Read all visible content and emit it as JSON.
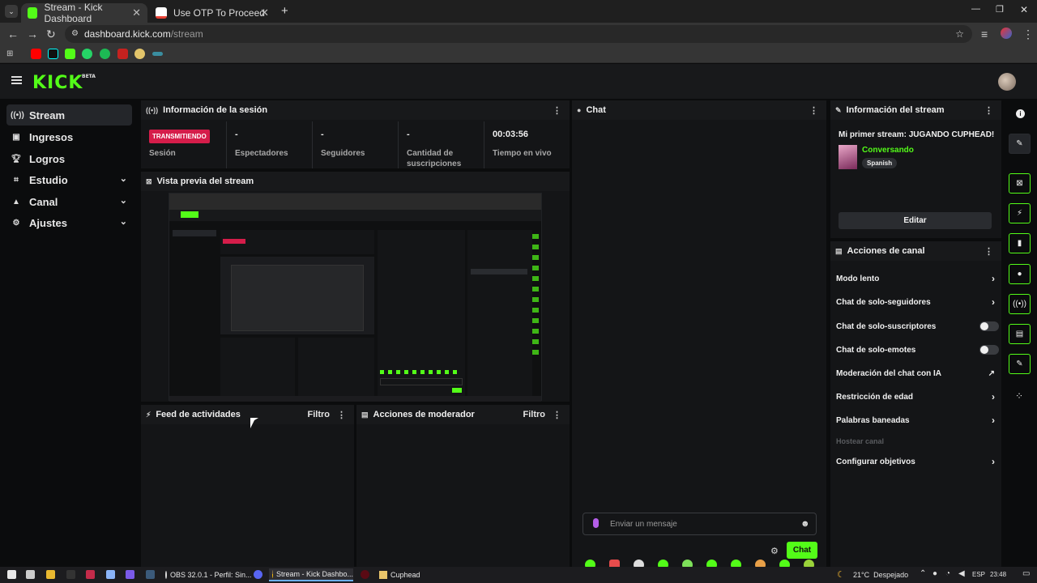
{
  "browser": {
    "tabs": [
      {
        "label": "Stream - Kick Dashboard"
      },
      {
        "label": "Use OTP To Proceed - dienteJe..."
      }
    ],
    "url_host": "dashboard.kick.com",
    "url_path": "/stream"
  },
  "app": {
    "logo": "KICK",
    "logo_tag": "BETA"
  },
  "sidebar": {
    "items": [
      {
        "label": "Stream",
        "icon": "broadcast-icon"
      },
      {
        "label": "Ingresos",
        "icon": "income-icon"
      },
      {
        "label": "Logros",
        "icon": "trophy-icon"
      },
      {
        "label": "Estudio",
        "icon": "studio-icon"
      },
      {
        "label": "Canal",
        "icon": "channel-icon"
      },
      {
        "label": "Ajustes",
        "icon": "gear-icon"
      }
    ]
  },
  "session": {
    "title": "Información de la sesión",
    "live_badge": "TRANSMITIENDO",
    "stats": [
      {
        "value": "",
        "label": "Sesión"
      },
      {
        "value": "-",
        "label": "Espectadores"
      },
      {
        "value": "-",
        "label": "Seguidores"
      },
      {
        "value": "-",
        "label": "Cantidad de suscripciones"
      },
      {
        "value": "00:03:56",
        "label": "Tiempo en vivo"
      }
    ]
  },
  "preview": {
    "title": "Vista previa del stream"
  },
  "feed": {
    "title": "Feed de actividades",
    "filter": "Filtro"
  },
  "modactions": {
    "title": "Acciones de moderador",
    "filter": "Filtro"
  },
  "chat": {
    "title": "Chat",
    "input_placeholder": "Enviar un mensaje",
    "send_label": "Chat"
  },
  "stream_info": {
    "title": "Información del stream",
    "stream_title": "Mi primer stream: JUGANDO CUPHEAD!",
    "category": "Conversando",
    "language": "Spanish",
    "edit_label": "Editar"
  },
  "channel_actions": {
    "title": "Acciones de canal",
    "items": [
      {
        "label": "Modo lento",
        "control": "chevron"
      },
      {
        "label": "Chat de solo-seguidores",
        "control": "chevron"
      },
      {
        "label": "Chat de solo-suscriptores",
        "control": "toggle"
      },
      {
        "label": "Chat de solo-emotes",
        "control": "toggle"
      },
      {
        "label": "Moderación del chat con IA",
        "control": "external"
      },
      {
        "label": "Restricción de edad",
        "control": "chevron"
      },
      {
        "label": "Palabras baneadas",
        "control": "chevron"
      },
      {
        "label": "Hostear canal",
        "control": "none"
      },
      {
        "label": "Configurar objetivos",
        "control": "chevron"
      }
    ],
    "toggles": {
      "solo_suscriptores": false,
      "solo_emotes": false
    }
  },
  "taskbar": {
    "apps": [
      {
        "label": "OBS 32.0.1 - Perfil: Sin..."
      },
      {
        "label": "Stream - Kick Dashbo..."
      },
      {
        "label": "Cuphead"
      }
    ],
    "weather": "21°C  Despejado",
    "lang": "ESP",
    "clock": "23:48"
  },
  "colors": {
    "accent": "#53fc18",
    "live": "#d51d4a",
    "panel": "#141517"
  }
}
